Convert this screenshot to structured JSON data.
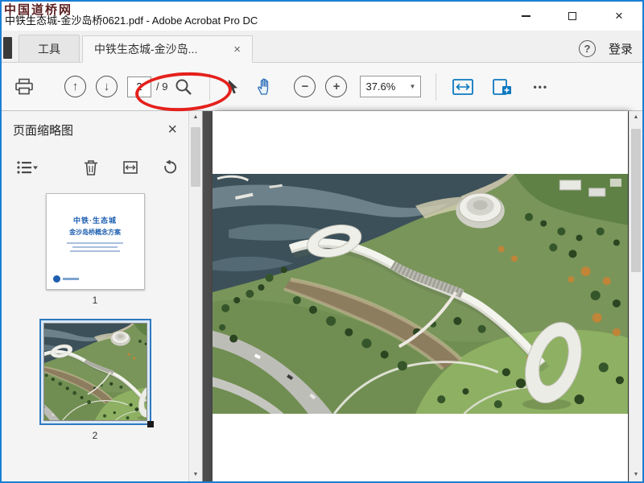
{
  "watermark": "中国道桥网",
  "titlebar": {
    "title": "中铁生态城-金沙岛桥0621.pdf - Adobe Acrobat Pro DC",
    "close_glyph": "×"
  },
  "tabbar": {
    "tools_tab": "工具",
    "document_tab": "中铁生态城-金沙岛...",
    "tab_close_glyph": "×",
    "help_glyph": "?",
    "sign_in": "登录"
  },
  "toolbar": {
    "page_current": "2",
    "page_total": "/ 9",
    "zoom_value": "37.6%",
    "more_glyph": "•••"
  },
  "icons": {
    "page_up": "↑",
    "page_down": "↓",
    "zoom_out": "−",
    "zoom_in": "+",
    "caret_down": "▼",
    "scroll_up": "▲",
    "scroll_down": "▼"
  },
  "sidebar": {
    "title": "页面缩略图",
    "close_glyph": "×",
    "cover": {
      "line1": "中铁·生态城",
      "line2": "金沙岛桥概念方案"
    },
    "pages": [
      {
        "number": "1"
      },
      {
        "number": "2"
      }
    ]
  }
}
